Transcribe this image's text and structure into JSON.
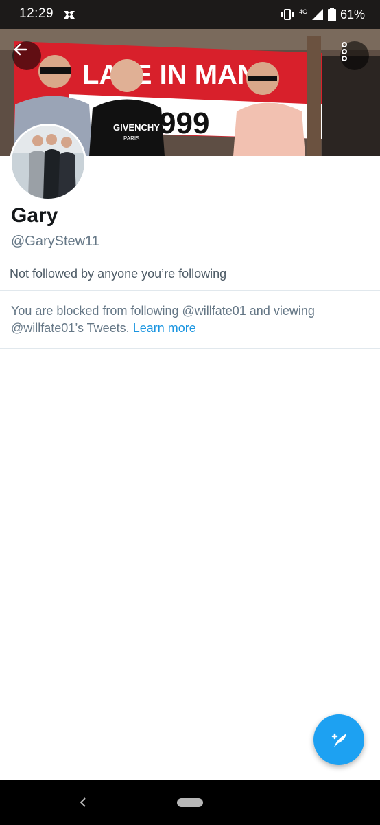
{
  "status_bar": {
    "time": "12:29",
    "network": "4G",
    "battery": "61%"
  },
  "banner": {
    "flag_text": "LATE IN MAN",
    "number_text": "999",
    "shirt_text": "GIVENCHY",
    "shirt_subtext": "PARIS"
  },
  "profile": {
    "name": "Gary",
    "handle": "@GaryStew11",
    "followers_note": "Not followed by anyone you’re following"
  },
  "blocked": {
    "message": "You are blocked from following @willfate01 and viewing @willfate01’s Tweets.",
    "link": "Learn more"
  },
  "colors": {
    "accent": "#1da1f2",
    "link": "#1b95e0",
    "text_primary": "#14171a",
    "text_secondary": "#657786",
    "divider": "#e1e8ed"
  },
  "icons": {
    "back": "arrow-left-icon",
    "more": "more-vertical-icon",
    "compose": "compose-tweet-icon",
    "nav_back": "chevron-left-icon"
  }
}
